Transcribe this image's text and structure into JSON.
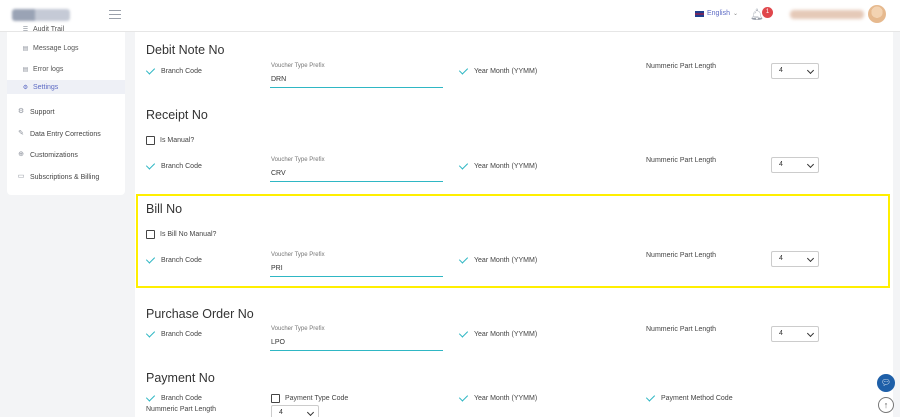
{
  "header": {
    "language": "English",
    "notification_count": "1",
    "colors": {
      "accent": "#5c6ac4",
      "badge": "#e0474c"
    }
  },
  "sidebar": {
    "sub_items": [
      {
        "label": "Audit Trail",
        "icon": "list-icon"
      },
      {
        "label": "Message Logs",
        "icon": "document-icon"
      },
      {
        "label": "Error logs",
        "icon": "document-icon"
      },
      {
        "label": "Settings",
        "icon": "gear-icon"
      }
    ],
    "main_items": [
      {
        "label": "Support",
        "icon": "gear-icon"
      },
      {
        "label": "Data Entry Corrections",
        "icon": "edit-icon"
      },
      {
        "label": "Customizations",
        "icon": "plus-circle-icon"
      },
      {
        "label": "Subscriptions & Billing",
        "icon": "folder-icon"
      }
    ]
  },
  "common": {
    "branch_code": "Branch Code",
    "voucher_prefix": "Voucher Type Prefix",
    "year_month": "Year Month (YYMM)",
    "numeric_part_length": "Nummeric Part Length"
  },
  "sections": {
    "debit_note": {
      "title": "Debit Note No",
      "prefix": "DRN",
      "length": "4"
    },
    "receipt": {
      "title": "Receipt No",
      "manual_label": "Is Manual?",
      "prefix": "CRV",
      "length": "4"
    },
    "bill": {
      "title": "Bill No",
      "manual_label": "Is Bill No Manual?",
      "prefix": "PRI",
      "length": "4"
    },
    "purchase_order": {
      "title": "Purchase Order No",
      "prefix": "LPO",
      "length": "4"
    },
    "payment": {
      "title": "Payment No",
      "payment_type_code": "Payment Type Code",
      "payment_method_code": "Payment Method Code",
      "length": "4"
    }
  }
}
